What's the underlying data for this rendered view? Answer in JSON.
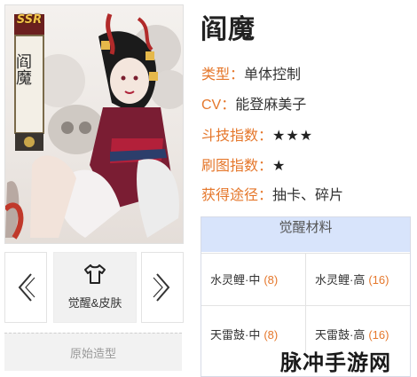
{
  "shikigami": {
    "rarity": "SSR",
    "scroll_name": "阎魔",
    "name": "阎魔"
  },
  "info": [
    {
      "key": "类型：",
      "value": "单体控制"
    },
    {
      "key": "CV：",
      "value": "能登麻美子"
    },
    {
      "key": "斗技指数：",
      "value": "★★★"
    },
    {
      "key": "刷图指数：",
      "value": "★"
    },
    {
      "key": "获得途径：",
      "value": "抽卡、碎片"
    }
  ],
  "buttons": {
    "skin_label": "觉醒&皮肤",
    "original_label": "原始造型"
  },
  "materials": {
    "header": "觉醒材料",
    "items": [
      {
        "name": "水灵鲤·中",
        "count": "(8)"
      },
      {
        "name": "水灵鲤·高",
        "count": "(16)"
      },
      {
        "name": "天雷鼓·中",
        "count": "(8)"
      },
      {
        "name": "天雷鼓·高",
        "count": "(16)"
      }
    ]
  },
  "watermark": "脉冲手游网",
  "colors": {
    "accent": "#e5772b",
    "header_bg": "#d8e4fb"
  },
  "icons": [
    "chevron-left-icon",
    "shirt-icon",
    "chevron-right-icon"
  ]
}
